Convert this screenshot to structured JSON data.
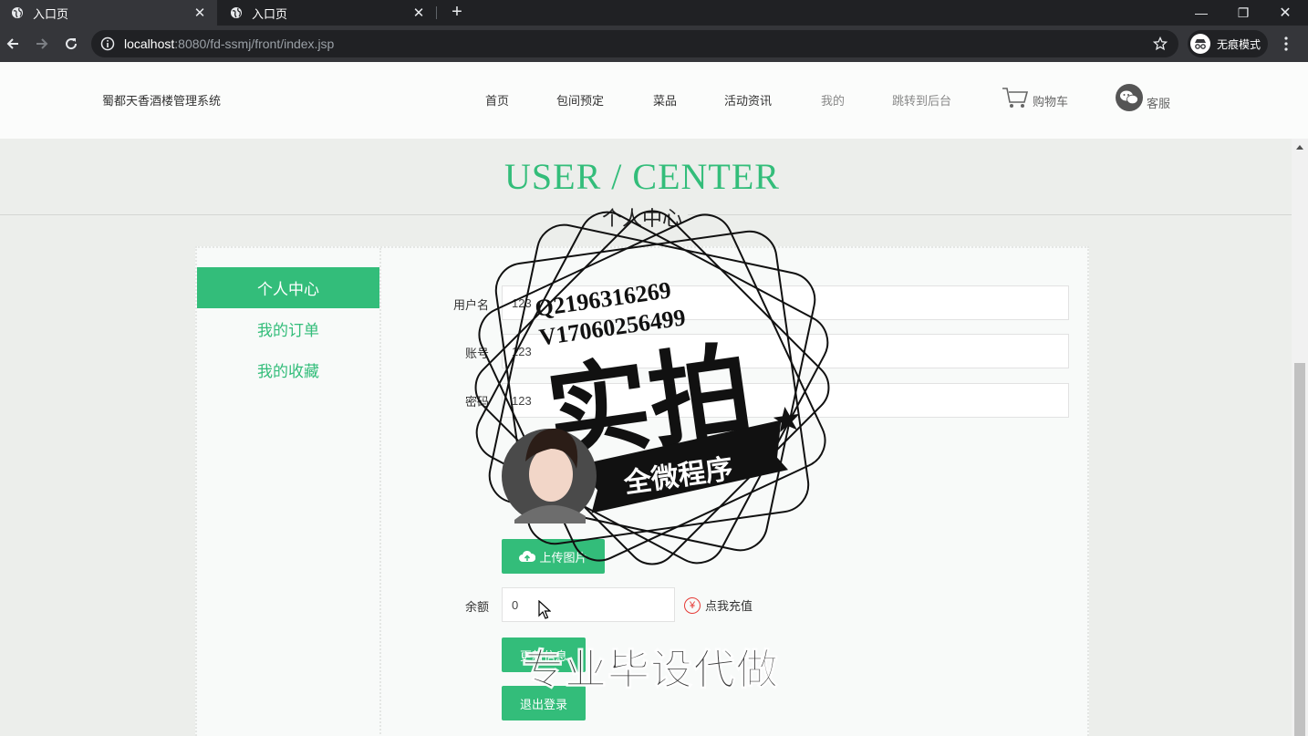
{
  "browser": {
    "tabs": [
      {
        "title": "入口页",
        "active": true
      },
      {
        "title": "入口页",
        "active": false
      }
    ],
    "url_host": "localhost",
    "url_path": ":8080/fd-ssmj/front/index.jsp",
    "incognito_label": "无痕模式"
  },
  "header": {
    "brand": "蜀都天香酒楼管理系统",
    "nav": [
      "首页",
      "包间预定",
      "菜品",
      "活动资讯",
      "我的",
      "跳转到后台"
    ],
    "cart": "购物车",
    "service": "客服"
  },
  "page": {
    "title": "USER / CENTER",
    "subtitle": "个人中心"
  },
  "sidebar": {
    "items": [
      "个人中心",
      "我的订单",
      "我的收藏"
    ]
  },
  "form": {
    "username_label": "用户名",
    "username_value": "123",
    "account_label": "账号",
    "account_value": "123",
    "password_label": "密码",
    "password_value": "123",
    "upload_label": "上传图片",
    "balance_label": "余额",
    "balance_value": "0",
    "recharge_label": "点我充值",
    "update_label": "更新信息",
    "logout_label": "退出登录"
  },
  "watermark": {
    "contact_q": "Q2196316269",
    "contact_v": "V17060256499",
    "big_text": "实拍",
    "ribbon": "全微程序",
    "promo": "专业毕设代做"
  },
  "colors": {
    "accent": "#33bd7a",
    "chrome_dark": "#202124",
    "chrome_mid": "#35363a"
  }
}
